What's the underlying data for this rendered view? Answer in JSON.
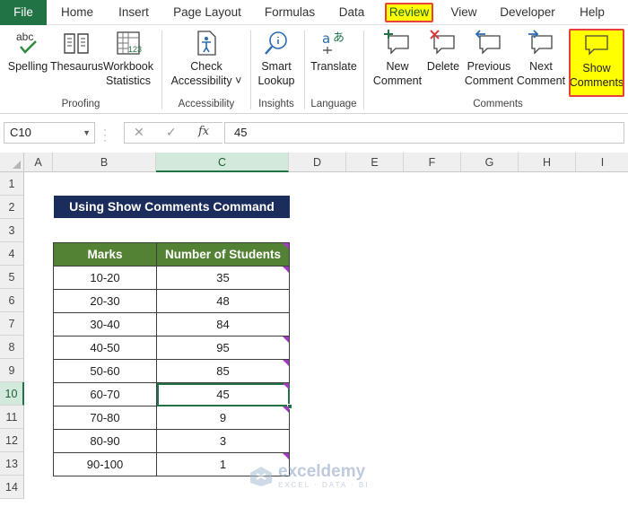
{
  "colors": {
    "accent": "#217346",
    "highlight": "#ffff00",
    "highlight_border": "#e8403a",
    "header_fill": "#548235",
    "title_fill": "#1a2d5c",
    "comment_indicator": "#a03cc0"
  },
  "tabs": [
    "File",
    "Home",
    "Insert",
    "Page Layout",
    "Formulas",
    "Data",
    "Review",
    "View",
    "Developer",
    "Help"
  ],
  "ribbon": {
    "proofing": {
      "label": "Proofing",
      "spelling": "Spelling",
      "spelling_icon_text": "abc",
      "thesaurus": "Thesaurus",
      "workbook_stats_1": "Workbook",
      "workbook_stats_2": "Statistics",
      "stats_icon_text": "123"
    },
    "accessibility": {
      "label": "Accessibility",
      "check_1": "Check",
      "check_2": "Accessibility ˅"
    },
    "insights": {
      "label": "Insights",
      "smart_1": "Smart",
      "smart_2": "Lookup"
    },
    "language": {
      "label": "Language",
      "translate": "Translate"
    },
    "comments": {
      "label": "Comments",
      "new_1": "New",
      "new_2": "Comment",
      "delete": "Delete",
      "prev_1": "Previous",
      "prev_2": "Comment",
      "next_1": "Next",
      "next_2": "Comment",
      "show_1": "Show",
      "show_2": "Comments"
    }
  },
  "formula_bar": {
    "name_box": "C10",
    "fx": "fx",
    "value": "45"
  },
  "grid": {
    "columns": [
      "A",
      "B",
      "C",
      "D",
      "E",
      "F",
      "G",
      "H",
      "I"
    ],
    "selected_column": "C",
    "rows": [
      "1",
      "2",
      "3",
      "4",
      "5",
      "6",
      "7",
      "8",
      "9",
      "10",
      "11",
      "12",
      "13",
      "14"
    ],
    "selected_row": "10"
  },
  "sheet": {
    "title": "Using Show Comments Command",
    "headers": [
      "Marks",
      "Number of Students"
    ],
    "rows": [
      {
        "marks": "10-20",
        "students": "35"
      },
      {
        "marks": "20-30",
        "students": "48"
      },
      {
        "marks": "30-40",
        "students": "84"
      },
      {
        "marks": "40-50",
        "students": "95"
      },
      {
        "marks": "50-60",
        "students": "85"
      },
      {
        "marks": "60-70",
        "students": "45"
      },
      {
        "marks": "70-80",
        "students": "9"
      },
      {
        "marks": "80-90",
        "students": "3"
      },
      {
        "marks": "90-100",
        "students": "1"
      }
    ]
  },
  "watermark": {
    "name": "exceldemy",
    "tagline": "EXCEL · DATA · BI"
  }
}
